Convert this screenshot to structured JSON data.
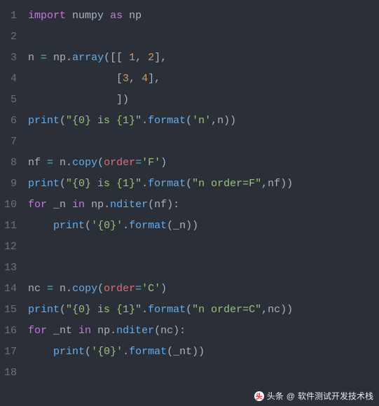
{
  "lines": [
    {
      "n": "1",
      "tokens": [
        {
          "t": "import",
          "c": "kw"
        },
        {
          "t": " ",
          "c": "plain"
        },
        {
          "t": "numpy",
          "c": "plain"
        },
        {
          "t": " ",
          "c": "plain"
        },
        {
          "t": "as",
          "c": "kw"
        },
        {
          "t": " ",
          "c": "plain"
        },
        {
          "t": "np",
          "c": "plain"
        }
      ]
    },
    {
      "n": "2",
      "tokens": []
    },
    {
      "n": "3",
      "tokens": [
        {
          "t": "n ",
          "c": "plain"
        },
        {
          "t": "=",
          "c": "op"
        },
        {
          "t": " np.",
          "c": "plain"
        },
        {
          "t": "array",
          "c": "fn"
        },
        {
          "t": "([[ ",
          "c": "paren"
        },
        {
          "t": "1",
          "c": "num"
        },
        {
          "t": ", ",
          "c": "plain"
        },
        {
          "t": "2",
          "c": "num"
        },
        {
          "t": "],",
          "c": "paren"
        }
      ]
    },
    {
      "n": "4",
      "tokens": [
        {
          "t": "              [",
          "c": "paren"
        },
        {
          "t": "3",
          "c": "num"
        },
        {
          "t": ", ",
          "c": "plain"
        },
        {
          "t": "4",
          "c": "num"
        },
        {
          "t": "],",
          "c": "paren"
        }
      ]
    },
    {
      "n": "5",
      "tokens": [
        {
          "t": "              ])",
          "c": "paren"
        }
      ]
    },
    {
      "n": "6",
      "tokens": [
        {
          "t": "print",
          "c": "fn"
        },
        {
          "t": "(",
          "c": "paren"
        },
        {
          "t": "\"{0} is {1}\"",
          "c": "str"
        },
        {
          "t": ".",
          "c": "plain"
        },
        {
          "t": "format",
          "c": "fn"
        },
        {
          "t": "(",
          "c": "paren"
        },
        {
          "t": "'n'",
          "c": "str"
        },
        {
          "t": ",n))",
          "c": "paren"
        }
      ]
    },
    {
      "n": "7",
      "tokens": []
    },
    {
      "n": "8",
      "tokens": [
        {
          "t": "nf ",
          "c": "plain"
        },
        {
          "t": "=",
          "c": "op"
        },
        {
          "t": " n.",
          "c": "plain"
        },
        {
          "t": "copy",
          "c": "fn"
        },
        {
          "t": "(",
          "c": "paren"
        },
        {
          "t": "order",
          "c": "id"
        },
        {
          "t": "=",
          "c": "op"
        },
        {
          "t": "'F'",
          "c": "str"
        },
        {
          "t": ")",
          "c": "paren"
        }
      ]
    },
    {
      "n": "9",
      "tokens": [
        {
          "t": "print",
          "c": "fn"
        },
        {
          "t": "(",
          "c": "paren"
        },
        {
          "t": "\"{0} is {1}\"",
          "c": "str"
        },
        {
          "t": ".",
          "c": "plain"
        },
        {
          "t": "format",
          "c": "fn"
        },
        {
          "t": "(",
          "c": "paren"
        },
        {
          "t": "\"n order=F\"",
          "c": "str"
        },
        {
          "t": ",nf))",
          "c": "paren"
        }
      ]
    },
    {
      "n": "10",
      "tokens": [
        {
          "t": "for",
          "c": "kw"
        },
        {
          "t": " _n ",
          "c": "plain"
        },
        {
          "t": "in",
          "c": "kw"
        },
        {
          "t": " np.",
          "c": "plain"
        },
        {
          "t": "nditer",
          "c": "fn"
        },
        {
          "t": "(nf):",
          "c": "paren"
        }
      ]
    },
    {
      "n": "11",
      "tokens": [
        {
          "t": "    ",
          "c": "plain"
        },
        {
          "t": "print",
          "c": "fn"
        },
        {
          "t": "(",
          "c": "paren"
        },
        {
          "t": "'{0}'",
          "c": "str"
        },
        {
          "t": ".",
          "c": "plain"
        },
        {
          "t": "format",
          "c": "fn"
        },
        {
          "t": "(_n))",
          "c": "paren"
        }
      ]
    },
    {
      "n": "12",
      "tokens": []
    },
    {
      "n": "13",
      "tokens": []
    },
    {
      "n": "14",
      "tokens": [
        {
          "t": "nc ",
          "c": "plain"
        },
        {
          "t": "=",
          "c": "op"
        },
        {
          "t": " n.",
          "c": "plain"
        },
        {
          "t": "copy",
          "c": "fn"
        },
        {
          "t": "(",
          "c": "paren"
        },
        {
          "t": "order",
          "c": "id"
        },
        {
          "t": "=",
          "c": "op"
        },
        {
          "t": "'C'",
          "c": "str"
        },
        {
          "t": ")",
          "c": "paren"
        }
      ]
    },
    {
      "n": "15",
      "tokens": [
        {
          "t": "print",
          "c": "fn"
        },
        {
          "t": "(",
          "c": "paren"
        },
        {
          "t": "\"{0} is {1}\"",
          "c": "str"
        },
        {
          "t": ".",
          "c": "plain"
        },
        {
          "t": "format",
          "c": "fn"
        },
        {
          "t": "(",
          "c": "paren"
        },
        {
          "t": "\"n order=C\"",
          "c": "str"
        },
        {
          "t": ",nc))",
          "c": "paren"
        }
      ]
    },
    {
      "n": "16",
      "tokens": [
        {
          "t": "for",
          "c": "kw"
        },
        {
          "t": " _nt ",
          "c": "plain"
        },
        {
          "t": "in",
          "c": "kw"
        },
        {
          "t": " np.",
          "c": "plain"
        },
        {
          "t": "nditer",
          "c": "fn"
        },
        {
          "t": "(nc):",
          "c": "paren"
        }
      ]
    },
    {
      "n": "17",
      "tokens": [
        {
          "t": "    ",
          "c": "plain"
        },
        {
          "t": "print",
          "c": "fn"
        },
        {
          "t": "(",
          "c": "paren"
        },
        {
          "t": "'{0}'",
          "c": "str"
        },
        {
          "t": ".",
          "c": "plain"
        },
        {
          "t": "format",
          "c": "fn"
        },
        {
          "t": "(_nt))",
          "c": "paren"
        }
      ]
    },
    {
      "n": "18",
      "tokens": []
    }
  ],
  "watermark": {
    "prefix": "头条",
    "at": "@",
    "text": "软件测试开发技术栈"
  }
}
